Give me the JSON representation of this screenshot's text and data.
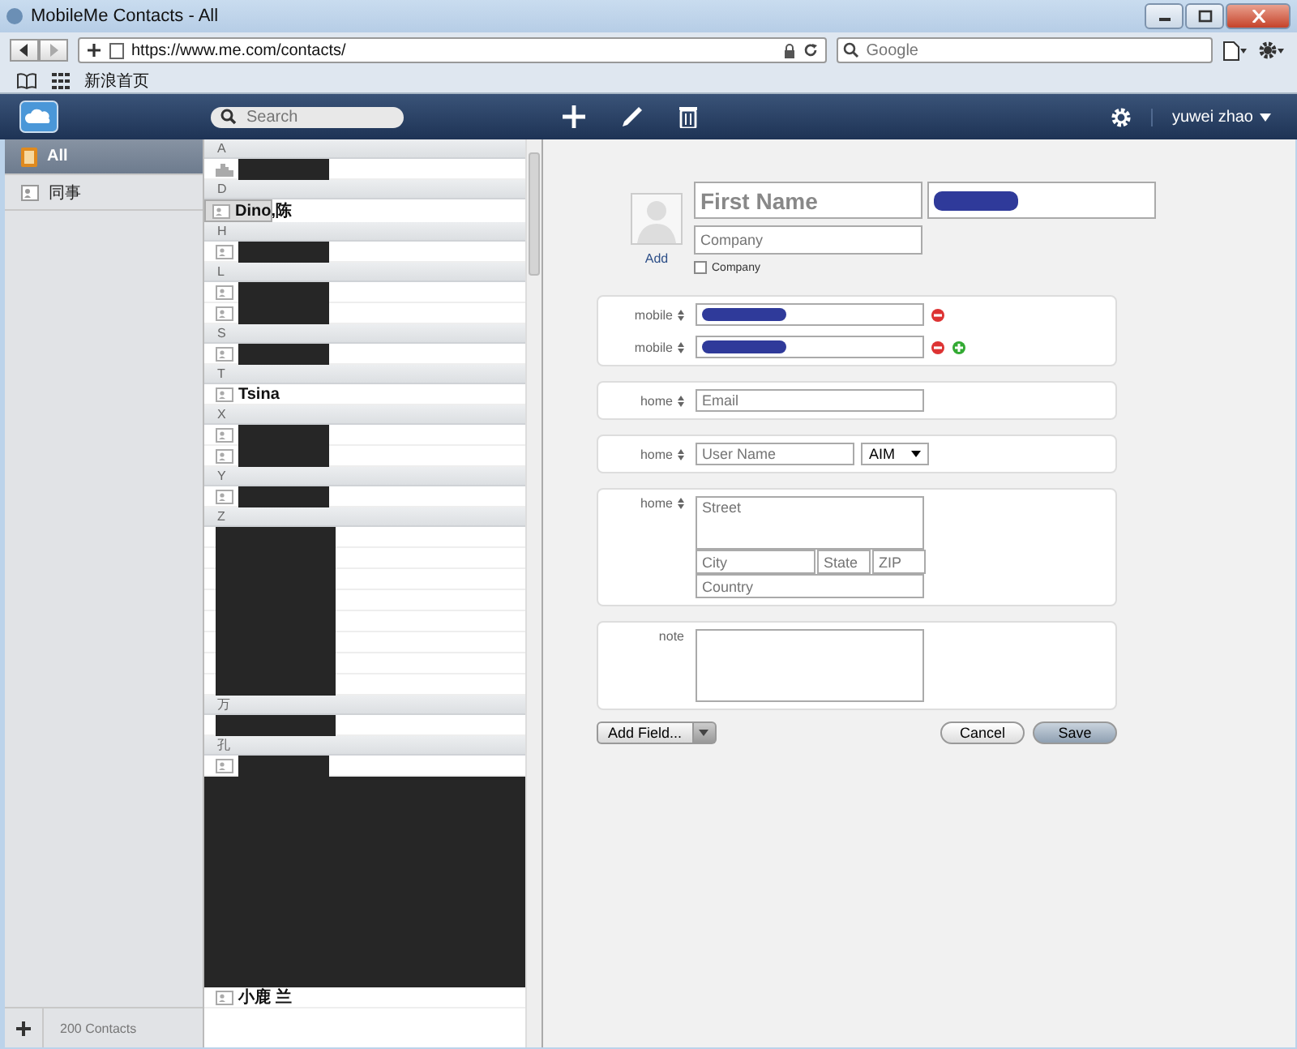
{
  "window": {
    "title": "MobileMe Contacts - All"
  },
  "browser": {
    "url": "https://www.me.com/contacts/",
    "search": {
      "placeholder": "Google"
    },
    "bookmarks": [
      {
        "label": "新浪首页"
      }
    ]
  },
  "app_bar": {
    "search": {
      "placeholder": "Search"
    },
    "user": "yuwei zhao"
  },
  "sidebar": {
    "items": [
      {
        "label": "All",
        "kind": "book",
        "selected": true
      },
      {
        "label": "同事",
        "kind": "group",
        "selected": false
      }
    ],
    "count": "200 Contacts"
  },
  "contact_list": {
    "sections": [
      {
        "letter": "A",
        "contacts": [
          {
            "kind": "group",
            "redacted": true,
            "selected": false
          }
        ]
      },
      {
        "letter": "D",
        "contacts": [
          {
            "kind": "person",
            "name": "Dino,陈",
            "redacted": false,
            "selected": true
          }
        ]
      },
      {
        "letter": "H",
        "contacts": [
          {
            "kind": "person",
            "redacted": true,
            "selected": false
          }
        ]
      },
      {
        "letter": "L",
        "contacts": [
          {
            "kind": "person",
            "redacted": true,
            "selected": false
          },
          {
            "kind": "person",
            "redacted": true,
            "selected": false
          }
        ]
      },
      {
        "letter": "S",
        "contacts": [
          {
            "kind": "person",
            "redacted": true,
            "selected": false
          }
        ]
      },
      {
        "letter": "T",
        "contacts": [
          {
            "kind": "person",
            "name": "Tsina",
            "redacted": false,
            "selected": false
          }
        ]
      },
      {
        "letter": "X",
        "contacts": [
          {
            "kind": "person",
            "redacted": true,
            "selected": false
          },
          {
            "kind": "person",
            "redacted": true,
            "selected": false
          }
        ]
      },
      {
        "letter": "Y",
        "contacts": [
          {
            "kind": "person",
            "redacted": true,
            "selected": false
          }
        ]
      },
      {
        "letter": "Z",
        "contacts": [
          {
            "kind": "blank",
            "redacted": true,
            "selected": false
          },
          {
            "kind": "blank",
            "redacted": true,
            "selected": false
          },
          {
            "kind": "blank",
            "redacted": true,
            "selected": false
          },
          {
            "kind": "blank",
            "redacted": true,
            "selected": false
          },
          {
            "kind": "blank",
            "redacted": true,
            "selected": false
          },
          {
            "kind": "blank",
            "redacted": true,
            "selected": false
          },
          {
            "kind": "blank",
            "redacted": true,
            "selected": false
          },
          {
            "kind": "blank",
            "redacted": true,
            "selected": false
          }
        ]
      },
      {
        "letter": "万",
        "contacts": [
          {
            "kind": "blank",
            "redacted": true,
            "selected": false
          }
        ]
      },
      {
        "letter": "孔",
        "contacts": [
          {
            "kind": "person",
            "redacted": true,
            "selected": false
          },
          {
            "kind": "covered",
            "redacted": true,
            "selected": false
          },
          {
            "kind": "covered",
            "redacted": true,
            "selected": false
          },
          {
            "kind": "covered",
            "redacted": true,
            "selected": false
          },
          {
            "kind": "covered",
            "redacted": true,
            "selected": false
          },
          {
            "kind": "covered",
            "redacted": true,
            "selected": false
          },
          {
            "kind": "covered",
            "redacted": true,
            "selected": false
          },
          {
            "kind": "covered",
            "redacted": true,
            "selected": false
          },
          {
            "kind": "covered",
            "redacted": true,
            "selected": false
          },
          {
            "kind": "covered",
            "redacted": true,
            "selected": false
          },
          {
            "kind": "covered",
            "redacted": true,
            "selected": false
          },
          {
            "kind": "person",
            "name": "小鹿 兰",
            "redacted": false,
            "selected": false
          }
        ]
      }
    ]
  },
  "card": {
    "photo_link": "Add",
    "first_name": {
      "placeholder": "First Name"
    },
    "last_name": {
      "redacted": true
    },
    "company": {
      "placeholder": "Company"
    },
    "company_checkbox": {
      "label": "Company",
      "checked": false
    },
    "phones": [
      {
        "label": "mobile",
        "redacted": true,
        "can_add": false
      },
      {
        "label": "mobile",
        "redacted": true,
        "can_add": true
      }
    ],
    "email": {
      "label": "home",
      "placeholder": "Email"
    },
    "im": {
      "label": "home",
      "placeholder": "User Name",
      "service": "AIM"
    },
    "address": {
      "label": "home",
      "street": {
        "placeholder": "Street"
      },
      "city": {
        "placeholder": "City"
      },
      "state": {
        "placeholder": "State"
      },
      "zip": {
        "placeholder": "ZIP"
      },
      "country": {
        "placeholder": "Country"
      }
    },
    "note": {
      "label": "note"
    },
    "buttons": {
      "add_field": "Add Field...",
      "cancel": "Cancel",
      "save": "Save"
    }
  }
}
